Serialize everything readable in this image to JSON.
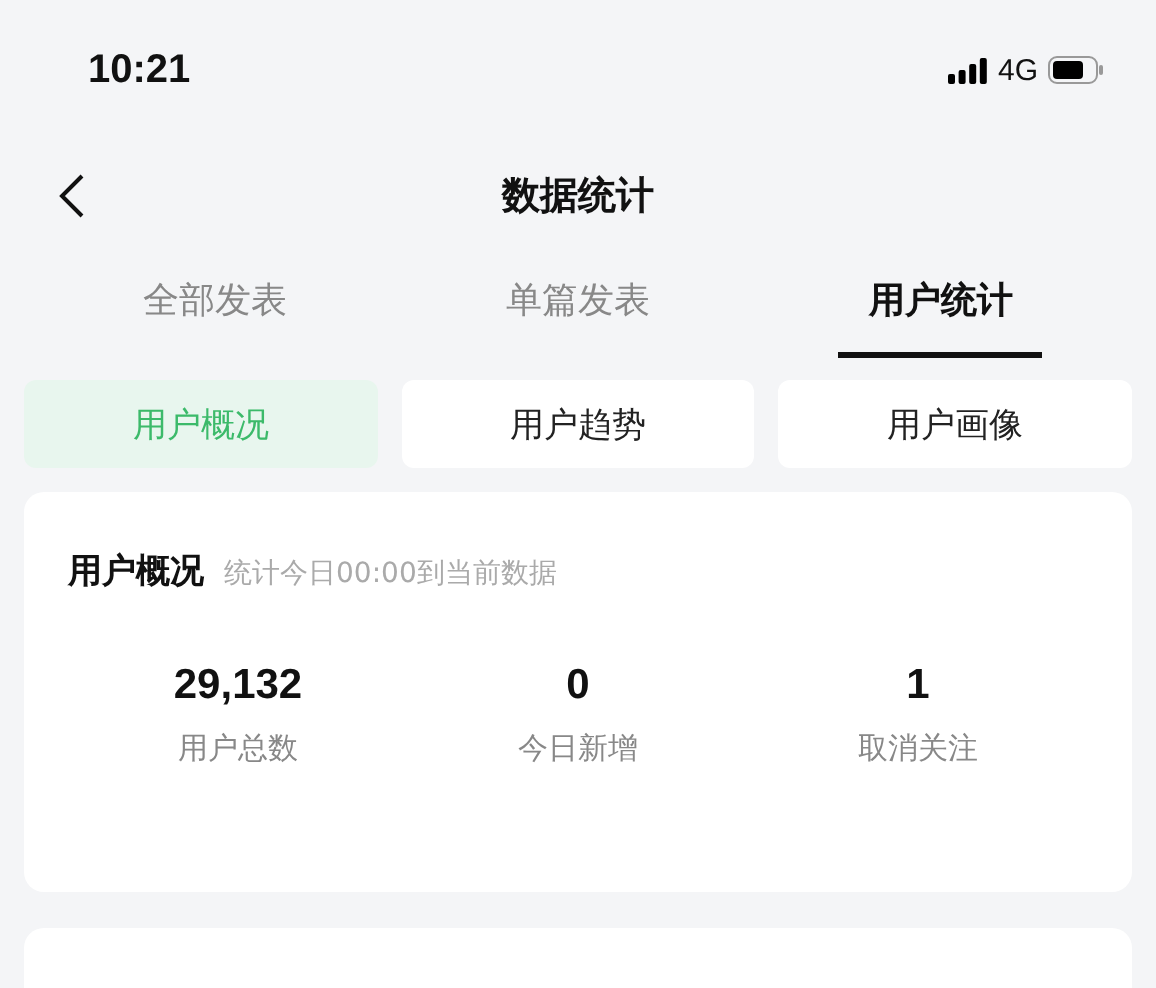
{
  "status_bar": {
    "time": "10:21",
    "network": "4G"
  },
  "nav": {
    "title": "数据统计"
  },
  "tabs": [
    {
      "label": "全部发表",
      "selected": false
    },
    {
      "label": "单篇发表",
      "selected": false
    },
    {
      "label": "用户统计",
      "selected": true
    }
  ],
  "segments": [
    {
      "label": "用户概况",
      "selected": true
    },
    {
      "label": "用户趋势",
      "selected": false
    },
    {
      "label": "用户画像",
      "selected": false
    }
  ],
  "overview": {
    "title": "用户概况",
    "subtitle": "统计今日00:00到当前数据",
    "stats": [
      {
        "value": "29,132",
        "label": "用户总数"
      },
      {
        "value": "0",
        "label": "今日新增"
      },
      {
        "value": "1",
        "label": "取消关注"
      }
    ]
  }
}
